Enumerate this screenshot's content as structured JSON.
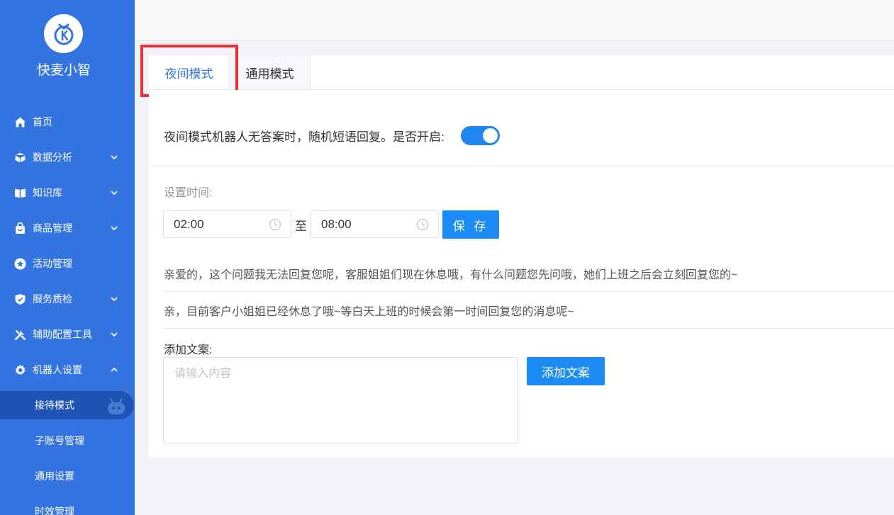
{
  "app": {
    "name": "快麦小智"
  },
  "sidebar": {
    "items": [
      {
        "label": "首页",
        "icon": "home-icon"
      },
      {
        "label": "数据分析",
        "icon": "cube-icon"
      },
      {
        "label": "知识库",
        "icon": "book-icon"
      },
      {
        "label": "商品管理",
        "icon": "shopping-bag-icon"
      },
      {
        "label": "活动管理",
        "icon": "star-circle-icon"
      },
      {
        "label": "服务质检",
        "icon": "shield-check-icon"
      },
      {
        "label": "辅助配置工具",
        "icon": "tools-icon"
      },
      {
        "label": "机器人设置",
        "icon": "gear-icon"
      }
    ],
    "sub_items": [
      {
        "label": "接待模式",
        "active": true
      },
      {
        "label": "子账号管理"
      },
      {
        "label": "通用设置"
      },
      {
        "label": "时效管理"
      }
    ]
  },
  "tabs": [
    {
      "label": "夜间模式",
      "active": true
    },
    {
      "label": "通用模式"
    }
  ],
  "night_mode": {
    "toggle_label": "夜间模式机器人无答案时，随机短语回复。是否开启:",
    "toggle_on": true,
    "time_label": "设置时间:",
    "start_time": "02:00",
    "to_label": "至",
    "end_time": "08:00",
    "save_label": "保 存",
    "replies": [
      "亲爱的，这个问题我无法回复您呢，客服姐姐们现在休息哦，有什么问题您先问哦，她们上班之后会立刻回复您的~",
      "亲，目前客户小姐姐已经休息了哦~等白天上班的时候会第一时间回复您的消息呢~"
    ],
    "add_label": "添加文案:",
    "add_placeholder": "请输入内容",
    "add_button": "添加文案"
  },
  "colors": {
    "sidebar": "#3474e0",
    "accent": "#1c8bf3",
    "highlight": "#ee2e30"
  }
}
